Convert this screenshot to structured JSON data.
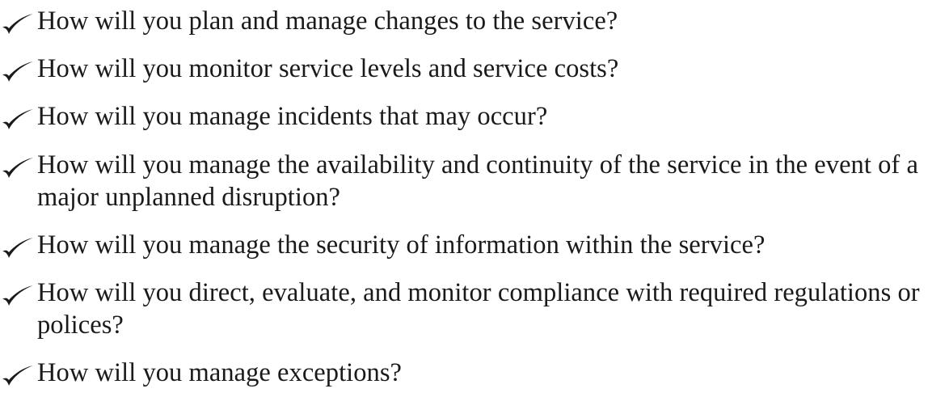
{
  "icons": {
    "bullet": "check-mark-icon",
    "bullet_color": "#1a1a1a"
  },
  "checklist": {
    "items": [
      {
        "text": "How will you plan and manage changes to the service?"
      },
      {
        "text": "How will you monitor service levels and service costs?"
      },
      {
        "text": "How will you manage incidents that may occur?"
      },
      {
        "text": "How will you manage the availability and continuity of the service in the event of a major unplanned disruption?"
      },
      {
        "text": "How will you manage the security of information within the service?"
      },
      {
        "text": "How will you direct, evaluate, and monitor compliance with required regulations or polices?"
      },
      {
        "text": "How will you manage exceptions?"
      }
    ]
  }
}
